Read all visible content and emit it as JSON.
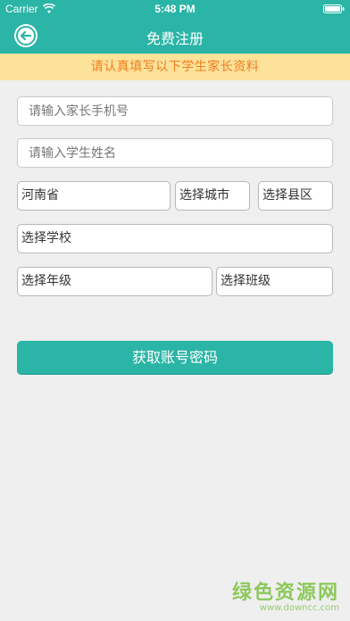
{
  "status_bar": {
    "carrier": "Carrier",
    "time": "5:48 PM",
    "wifi_icon": "wifi-icon",
    "battery_icon": "battery-icon"
  },
  "nav": {
    "back_icon": "arrow-left-circle-icon",
    "title": "免费注册"
  },
  "notice": {
    "text": "请认真填写以下学生家长资料"
  },
  "form": {
    "parent_phone_placeholder": "请输入家长手机号",
    "student_name_placeholder": "请输入学生姓名",
    "province_value": "河南省",
    "city_value": "选择城市",
    "county_value": "选择县区",
    "school_value": "选择学校",
    "grade_value": "选择年级",
    "class_value": "选择班级",
    "submit_label": "获取账号密码"
  },
  "watermark": {
    "brand": "绿色资源网",
    "url": "www.downcc.com"
  },
  "colors": {
    "primary": "#2bb5a6",
    "notice_bg": "#fde29a",
    "notice_text": "#ef7d1e",
    "background": "#efefef"
  }
}
